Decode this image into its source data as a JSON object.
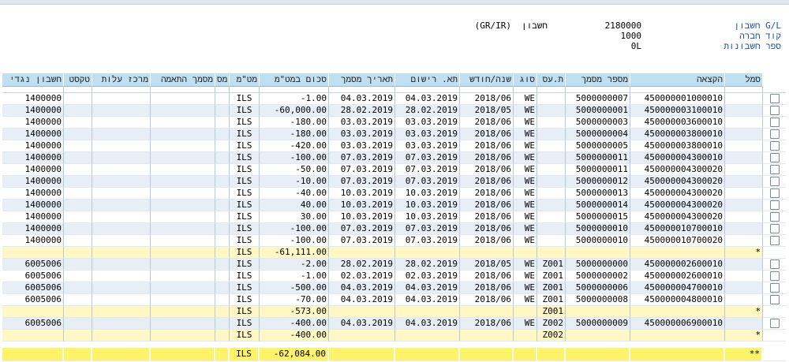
{
  "header": {
    "gl_label": "חשבון G/L",
    "gl_value": "2180000",
    "gl_desc_label": "חשבון",
    "gl_desc_value": "(GR/IR)",
    "company_label": "קוד חברה",
    "company_value": "1000",
    "ledger_label": "ספר חשבונות",
    "ledger_value": "0L"
  },
  "columns": [
    "חשבון נגדי",
    "טקסט",
    "מרכז עלות",
    "מסמך התאמה",
    "מס",
    "מט\"מ",
    "סכום במט\"מ",
    "תאריך מסמך",
    "תא. רישום",
    "שנה/חודש",
    "סוג",
    "ת.עס",
    "מספר מסמך",
    "הקצאה",
    "סמל"
  ],
  "rows": [
    {
      "type": "data",
      "offset": "1400000",
      "ccy": "ILS",
      "amount": "-1.00",
      "docdate": "04.03.2019",
      "postdate": "04.03.2019",
      "period": "2018/06",
      "dtype": "WE",
      "bt": "",
      "docno": "5000000007",
      "assign": "450000001000010",
      "mark": ""
    },
    {
      "type": "data",
      "offset": "1400000",
      "ccy": "ILS",
      "amount": "-60,000.00",
      "docdate": "28.02.2019",
      "postdate": "28.02.2019",
      "period": "2018/05",
      "dtype": "WE",
      "bt": "",
      "docno": "5000000001",
      "assign": "450000003100010",
      "mark": ""
    },
    {
      "type": "data",
      "offset": "1400000",
      "ccy": "ILS",
      "amount": "-180.00",
      "docdate": "03.03.2019",
      "postdate": "03.03.2019",
      "period": "2018/06",
      "dtype": "WE",
      "bt": "",
      "docno": "5000000003",
      "assign": "450000003600010",
      "mark": ""
    },
    {
      "type": "data",
      "offset": "1400000",
      "ccy": "ILS",
      "amount": "-180.00",
      "docdate": "03.03.2019",
      "postdate": "03.03.2019",
      "period": "2018/06",
      "dtype": "WE",
      "bt": "",
      "docno": "5000000004",
      "assign": "450000003800010",
      "mark": ""
    },
    {
      "type": "data",
      "offset": "1400000",
      "ccy": "ILS",
      "amount": "-420.00",
      "docdate": "03.03.2019",
      "postdate": "03.03.2019",
      "period": "2018/06",
      "dtype": "WE",
      "bt": "",
      "docno": "5000000005",
      "assign": "450000003800010",
      "mark": ""
    },
    {
      "type": "data",
      "offset": "1400000",
      "ccy": "ILS",
      "amount": "-100.00",
      "docdate": "07.03.2019",
      "postdate": "07.03.2019",
      "period": "2018/06",
      "dtype": "WE",
      "bt": "",
      "docno": "5000000011",
      "assign": "450000004300010",
      "mark": ""
    },
    {
      "type": "data",
      "offset": "1400000",
      "ccy": "ILS",
      "amount": "-50.00",
      "docdate": "07.03.2019",
      "postdate": "07.03.2019",
      "period": "2018/06",
      "dtype": "WE",
      "bt": "",
      "docno": "5000000011",
      "assign": "450000004300020",
      "mark": ""
    },
    {
      "type": "data",
      "offset": "1400000",
      "ccy": "ILS",
      "amount": "-10.00",
      "docdate": "07.03.2019",
      "postdate": "07.03.2019",
      "period": "2018/06",
      "dtype": "WE",
      "bt": "",
      "docno": "5000000012",
      "assign": "450000004300020",
      "mark": ""
    },
    {
      "type": "data",
      "offset": "1400000",
      "ccy": "ILS",
      "amount": "-40.00",
      "docdate": "10.03.2019",
      "postdate": "10.03.2019",
      "period": "2018/06",
      "dtype": "WE",
      "bt": "",
      "docno": "5000000013",
      "assign": "450000004300020",
      "mark": ""
    },
    {
      "type": "data",
      "offset": "1400000",
      "ccy": "ILS",
      "amount": "40.00",
      "docdate": "10.03.2019",
      "postdate": "10.03.2019",
      "period": "2018/06",
      "dtype": "WE",
      "bt": "",
      "docno": "5000000014",
      "assign": "450000004300020",
      "mark": ""
    },
    {
      "type": "data",
      "offset": "1400000",
      "ccy": "ILS",
      "amount": "30.00",
      "docdate": "10.03.2019",
      "postdate": "10.03.2019",
      "period": "2018/06",
      "dtype": "WE",
      "bt": "",
      "docno": "5000000015",
      "assign": "450000004300020",
      "mark": ""
    },
    {
      "type": "data",
      "offset": "1400000",
      "ccy": "ILS",
      "amount": "-100.00",
      "docdate": "07.03.2019",
      "postdate": "07.03.2019",
      "period": "2018/06",
      "dtype": "WE",
      "bt": "",
      "docno": "5000000010",
      "assign": "450000010700010",
      "mark": ""
    },
    {
      "type": "data",
      "offset": "1400000",
      "ccy": "ILS",
      "amount": "-100.00",
      "docdate": "07.03.2019",
      "postdate": "07.03.2019",
      "period": "2018/06",
      "dtype": "WE",
      "bt": "",
      "docno": "5000000010",
      "assign": "450000010700020",
      "mark": ""
    },
    {
      "type": "sub",
      "offset": "",
      "ccy": "ILS",
      "amount": "-61,111.00",
      "docdate": "",
      "postdate": "",
      "period": "",
      "dtype": "",
      "bt": "",
      "docno": "",
      "assign": "",
      "mark": "*"
    },
    {
      "type": "data",
      "offset": "6005006",
      "ccy": "ILS",
      "amount": "-2.00",
      "docdate": "28.02.2019",
      "postdate": "28.02.2019",
      "period": "2018/05",
      "dtype": "WE",
      "bt": "Z001",
      "docno": "5000000000",
      "assign": "450000002600010",
      "mark": ""
    },
    {
      "type": "data",
      "offset": "6005006",
      "ccy": "ILS",
      "amount": "-1.00",
      "docdate": "02.03.2019",
      "postdate": "02.03.2019",
      "period": "2018/06",
      "dtype": "WE",
      "bt": "Z001",
      "docno": "5000000002",
      "assign": "450000002600010",
      "mark": ""
    },
    {
      "type": "data",
      "offset": "6005006",
      "ccy": "ILS",
      "amount": "-500.00",
      "docdate": "04.03.2019",
      "postdate": "04.03.2019",
      "period": "2018/06",
      "dtype": "WE",
      "bt": "Z001",
      "docno": "5000000006",
      "assign": "450000004700010",
      "mark": ""
    },
    {
      "type": "data",
      "offset": "6005006",
      "ccy": "ILS",
      "amount": "-70.00",
      "docdate": "04.03.2019",
      "postdate": "04.03.2019",
      "period": "2018/06",
      "dtype": "WE",
      "bt": "Z001",
      "docno": "5000000008",
      "assign": "450000004800010",
      "mark": ""
    },
    {
      "type": "sub",
      "offset": "",
      "ccy": "ILS",
      "amount": "-573.00",
      "docdate": "",
      "postdate": "",
      "period": "",
      "dtype": "",
      "bt": "Z001",
      "docno": "",
      "assign": "",
      "mark": "*"
    },
    {
      "type": "data",
      "offset": "6005006",
      "ccy": "ILS",
      "amount": "-400.00",
      "docdate": "04.03.2019",
      "postdate": "04.03.2019",
      "period": "2018/06",
      "dtype": "WE",
      "bt": "Z002",
      "docno": "5000000009",
      "assign": "450000006900010",
      "mark": ""
    },
    {
      "type": "sub",
      "offset": "",
      "ccy": "ILS",
      "amount": "-400.00",
      "docdate": "",
      "postdate": "",
      "period": "",
      "dtype": "",
      "bt": "Z002",
      "docno": "",
      "assign": "",
      "mark": "*"
    }
  ],
  "total": {
    "ccy": "ILS",
    "amount": "-62,084.00",
    "mark": "**"
  }
}
